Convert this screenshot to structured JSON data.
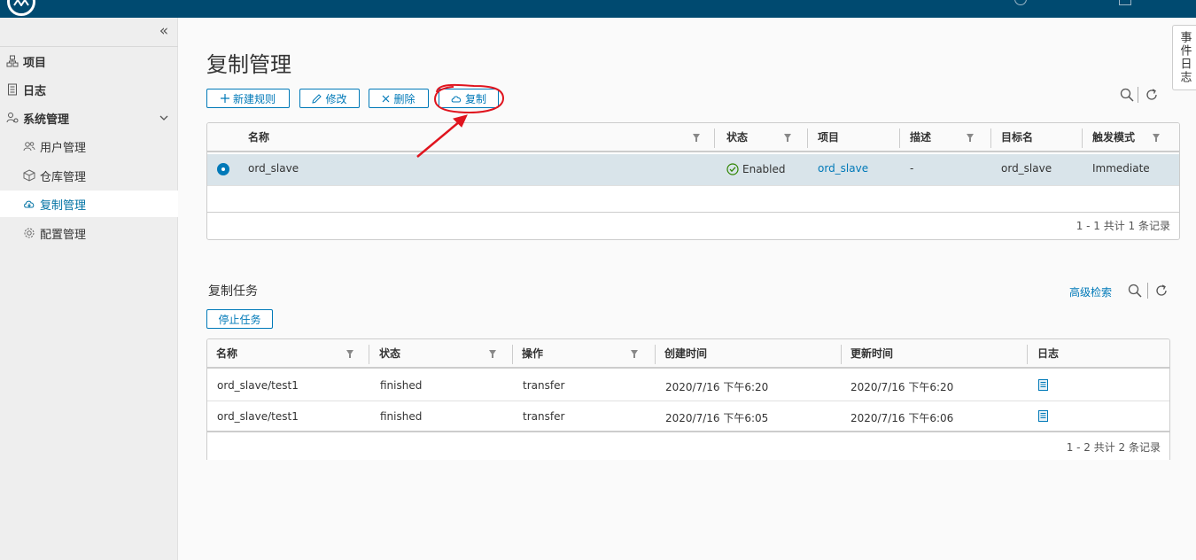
{
  "sidebar": {
    "items": [
      {
        "label": "项目"
      },
      {
        "label": "日志"
      },
      {
        "label": "系统管理"
      },
      {
        "label": "用户管理"
      },
      {
        "label": "仓库管理"
      },
      {
        "label": "复制管理"
      },
      {
        "label": "配置管理"
      }
    ]
  },
  "page": {
    "title": "复制管理"
  },
  "toolbar": {
    "new_rule": "新建规则",
    "edit": "修改",
    "delete": "删除",
    "replicate": "复制"
  },
  "rules_grid": {
    "columns": [
      "名称",
      "状态",
      "项目",
      "描述",
      "目标名",
      "触发模式"
    ],
    "rows": [
      {
        "name": "ord_slave",
        "status": "Enabled",
        "project": "ord_slave",
        "description": "-",
        "target": "ord_slave",
        "trigger": "Immediate"
      }
    ],
    "footer": "1 - 1 共计 1 条记录"
  },
  "tasks": {
    "title": "复制任务",
    "advanced_search": "高级检索",
    "stop_button": "停止任务",
    "columns": [
      "名称",
      "状态",
      "操作",
      "创建时间",
      "更新时间",
      "日志"
    ],
    "rows": [
      {
        "name": "ord_slave/test1",
        "status": "finished",
        "operation": "transfer",
        "created": "2020/7/16 下午6:20",
        "updated": "2020/7/16 下午6:20"
      },
      {
        "name": "ord_slave/test1",
        "status": "finished",
        "operation": "transfer",
        "created": "2020/7/16 下午6:05",
        "updated": "2020/7/16 下午6:06"
      }
    ],
    "footer": "1 - 2 共计 2 条记录"
  },
  "side_tab": "事件日志",
  "colors": {
    "header": "#004a70",
    "accent": "#0079b8",
    "annotation": "#e0141e",
    "success": "#2f8400"
  },
  "icons": [
    "logo-icon",
    "help-icon",
    "document-icon",
    "collapse-icon",
    "project-icon",
    "log-icon",
    "system-icon",
    "chevron-down-icon",
    "users-icon",
    "box-icon",
    "cloud-copy-icon",
    "gear-icon",
    "plus-icon",
    "pencil-icon",
    "close-icon",
    "search-icon",
    "refresh-icon",
    "check-circle-icon",
    "log-file-icon"
  ]
}
